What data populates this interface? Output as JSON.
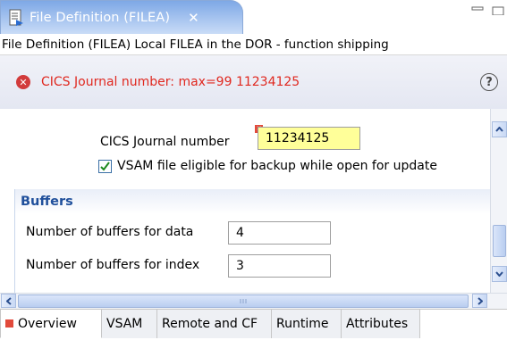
{
  "tab": {
    "title": "File Definition (FILEA)",
    "close": "✕"
  },
  "editor": {
    "header": "File Definition (FILEA) Local FILEA in the DOR - function shipping"
  },
  "error_banner": {
    "message": "CICS Journal number: max=99 11234125",
    "help": "?"
  },
  "form": {
    "journal_label": "CICS Journal number",
    "journal_value": "11234125",
    "vsam_backup_label": "VSAM file eligible for backup while open for update",
    "vsam_backup_checked": true,
    "buffers": {
      "heading": "Buffers",
      "data_label": "Number of buffers for data",
      "data_value": "4",
      "index_label": "Number of buffers for index",
      "index_value": "3"
    }
  },
  "bottom_tabs": [
    "Overview",
    "VSAM",
    "Remote and CF",
    "Runtime",
    "Attributes"
  ],
  "colors": {
    "error_text": "#e0281f",
    "required_field_bg": "#ffff99",
    "section_heading": "#1f4f9b",
    "tab_active": "#7ea8e6"
  }
}
